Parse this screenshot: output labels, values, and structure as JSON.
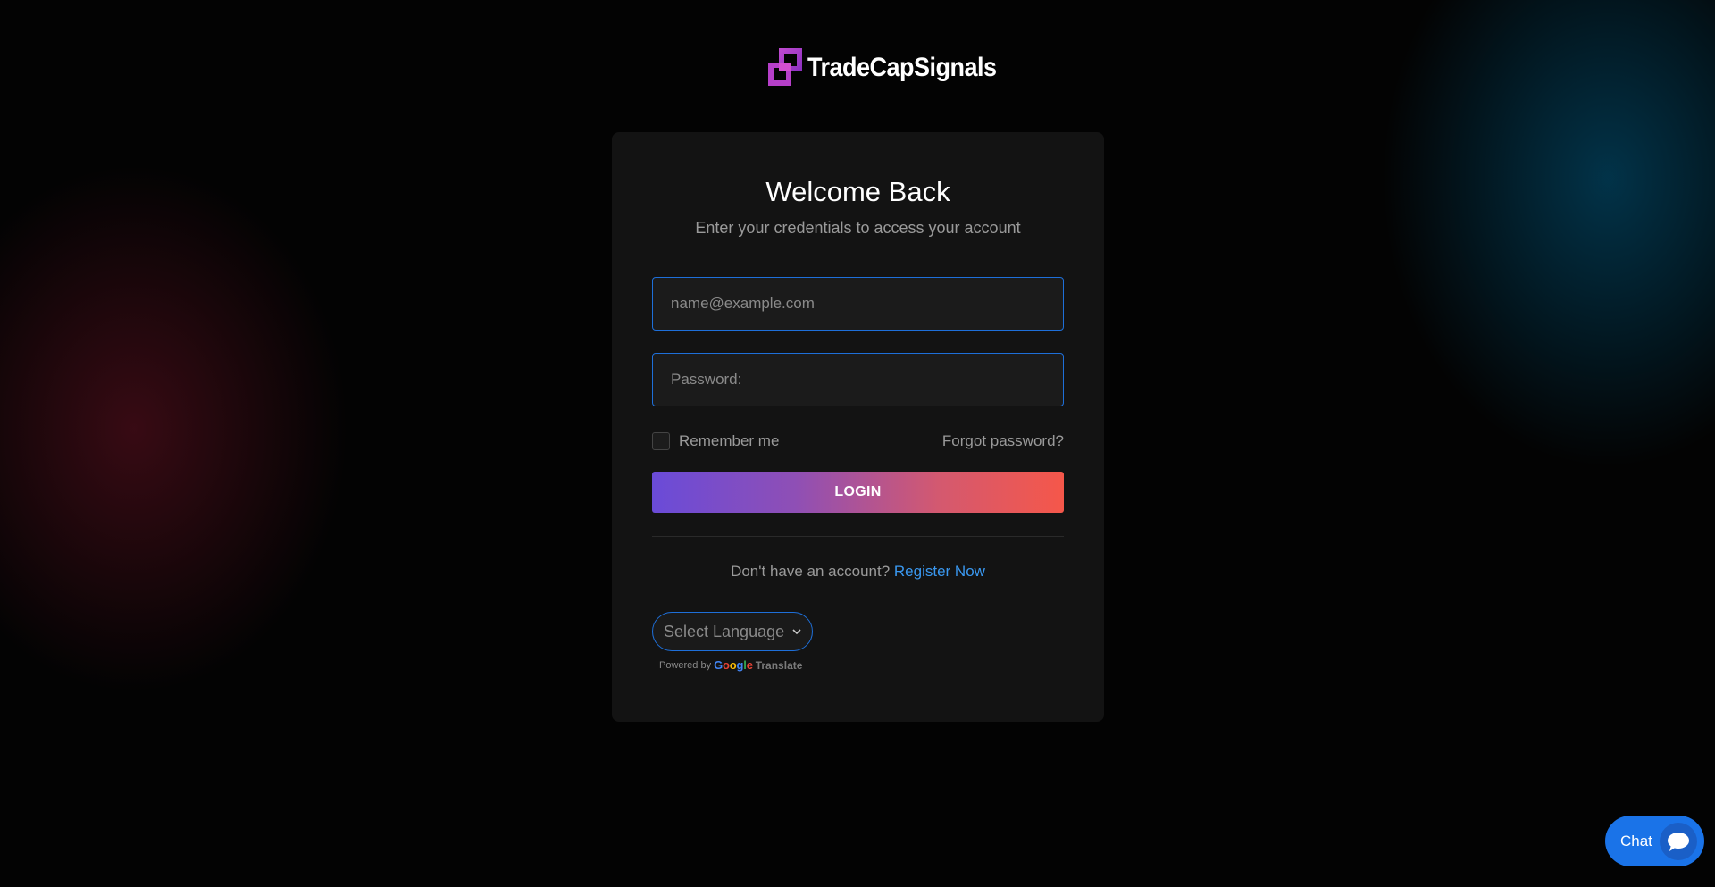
{
  "brand": {
    "name": "TradeCapSignals"
  },
  "login": {
    "title": "Welcome Back",
    "subtitle": "Enter your credentials to access your account",
    "email_placeholder": "name@example.com",
    "password_placeholder": "Password:",
    "remember_label": "Remember me",
    "forgot_label": "Forgot password?",
    "submit_label": "LOGIN",
    "register_prompt": "Don't have an account?",
    "register_label": "Register Now"
  },
  "translate": {
    "select_label": "Select Language",
    "powered_by": "Powered by",
    "translate_word": "Translate"
  },
  "chat": {
    "label": "Chat"
  },
  "colors": {
    "accent": "#1e6fd9",
    "link": "#3a98f0",
    "gradient_start": "#6a4bd8",
    "gradient_end": "#f5574a",
    "chat_bg": "#1a73e8"
  }
}
